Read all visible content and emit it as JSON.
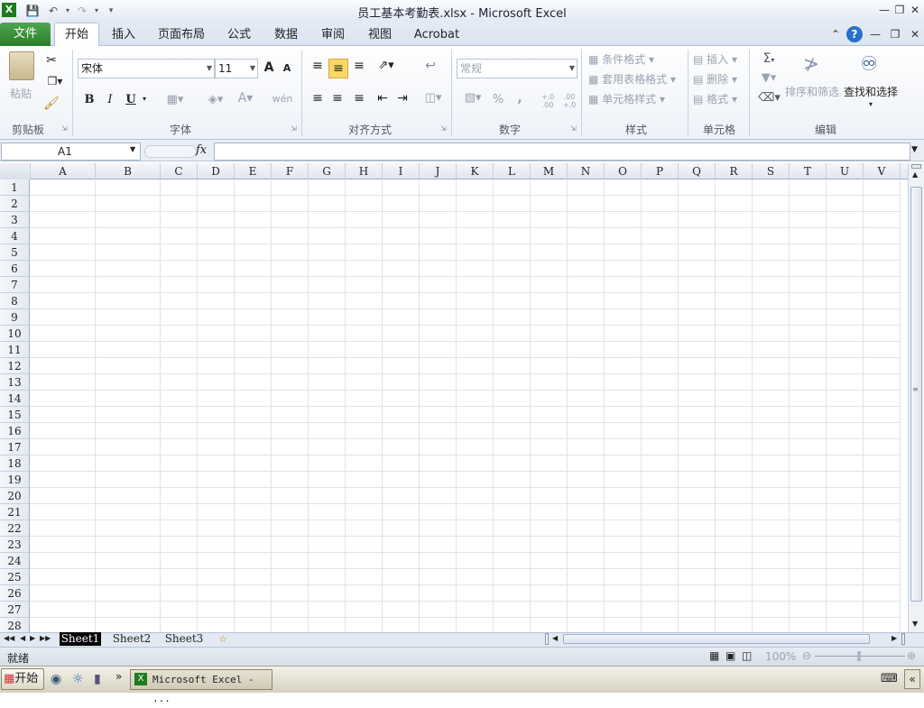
{
  "window": {
    "title": "员工基本考勤表.xlsx - Microsoft Excel"
  },
  "ribbon_tabs": [
    "文件",
    "开始",
    "插入",
    "页面布局",
    "公式",
    "数据",
    "审阅",
    "视图",
    "Acrobat"
  ],
  "clipboard": {
    "paste": "粘贴",
    "group": "剪贴板"
  },
  "font": {
    "name": "宋体",
    "size": "11",
    "group": "字体",
    "bold": "B",
    "italic": "I",
    "underline": "U",
    "grow": "A",
    "shrink": "A",
    "color_a": "A",
    "phonetic": "wén"
  },
  "alignment": {
    "group": "对齐方式"
  },
  "number": {
    "format": "常规",
    "group": "数字",
    "percent": "%",
    "comma": ",",
    "inc": "+.0 .00",
    "dec": ".00 +.0"
  },
  "styles": {
    "conditional": "条件格式",
    "table": "套用表格格式",
    "cell": "单元格样式",
    "group": "样式"
  },
  "cells": {
    "insert": "插入",
    "delete": "删除",
    "format": "格式",
    "group": "单元格"
  },
  "editing": {
    "sort": "排序和筛选",
    "find": "查找和选择",
    "group": "编辑",
    "sigma": "Σ"
  },
  "formula_bar": {
    "name_box": "A1",
    "fx": "fx",
    "value": ""
  },
  "columns": [
    "A",
    "B",
    "C",
    "D",
    "E",
    "F",
    "G",
    "H",
    "I",
    "J",
    "K",
    "L",
    "M",
    "N",
    "O",
    "P",
    "Q",
    "R",
    "S",
    "T",
    "U",
    "V"
  ],
  "rows": [
    "1",
    "2",
    "3",
    "4",
    "5",
    "6",
    "7",
    "8",
    "9",
    "10",
    "11",
    "12",
    "13",
    "14",
    "15",
    "16",
    "17",
    "18",
    "19",
    "20",
    "21",
    "22",
    "23",
    "24",
    "25",
    "26",
    "27",
    "28"
  ],
  "sheets": [
    "Sheet1",
    "Sheet2",
    "Sheet3"
  ],
  "status": {
    "ready": "就绪",
    "zoom": "100%"
  },
  "taskbar": {
    "start": "开始",
    "app": "Microsoft Excel - ..."
  },
  "colors": {
    "file_tab": "#2b7d2b",
    "accent": "#f9d867"
  }
}
